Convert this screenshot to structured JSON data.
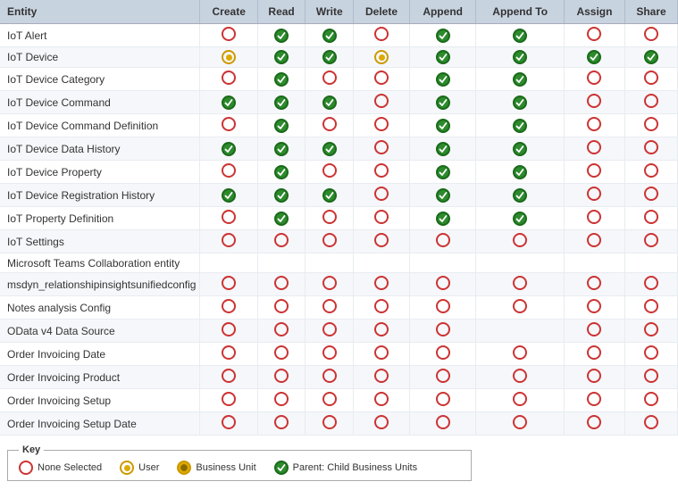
{
  "header": {
    "columns": [
      "Entity",
      "Create",
      "Read",
      "Write",
      "Delete",
      "Append",
      "Append To",
      "Assign",
      "Share"
    ]
  },
  "rows": [
    {
      "entity": "IoT Alert",
      "create": "none",
      "read": "parent",
      "write": "parent",
      "delete": "none",
      "append": "parent",
      "appendTo": "parent",
      "assign": "none",
      "share": "none"
    },
    {
      "entity": "IoT Device",
      "create": "user",
      "read": "parent",
      "write": "parent",
      "delete": "user",
      "append": "parent",
      "appendTo": "parent",
      "assign": "parent",
      "share": "parent"
    },
    {
      "entity": "IoT Device Category",
      "create": "none",
      "read": "parent",
      "write": "none",
      "delete": "none",
      "append": "parent",
      "appendTo": "parent",
      "assign": "none",
      "share": "none"
    },
    {
      "entity": "IoT Device Command",
      "create": "parent",
      "read": "parent",
      "write": "parent",
      "delete": "none",
      "append": "parent",
      "appendTo": "parent",
      "assign": "none",
      "share": "none"
    },
    {
      "entity": "IoT Device Command Definition",
      "create": "none",
      "read": "parent",
      "write": "none",
      "delete": "none",
      "append": "parent",
      "appendTo": "parent",
      "assign": "none",
      "share": "none"
    },
    {
      "entity": "IoT Device Data History",
      "create": "parent",
      "read": "parent",
      "write": "parent",
      "delete": "none",
      "append": "parent",
      "appendTo": "parent",
      "assign": "none",
      "share": "none"
    },
    {
      "entity": "IoT Device Property",
      "create": "none",
      "read": "parent",
      "write": "none",
      "delete": "none",
      "append": "parent",
      "appendTo": "parent",
      "assign": "none",
      "share": "none"
    },
    {
      "entity": "IoT Device Registration History",
      "create": "parent",
      "read": "parent",
      "write": "parent",
      "delete": "none",
      "append": "parent",
      "appendTo": "parent",
      "assign": "none",
      "share": "none"
    },
    {
      "entity": "IoT Property Definition",
      "create": "none",
      "read": "parent",
      "write": "none",
      "delete": "none",
      "append": "parent",
      "appendTo": "parent",
      "assign": "none",
      "share": "none"
    },
    {
      "entity": "IoT Settings",
      "create": "none",
      "read": "none",
      "write": "none",
      "delete": "none",
      "append": "none",
      "appendTo": "none",
      "assign": "none",
      "share": "none"
    },
    {
      "entity": "Microsoft Teams Collaboration entity",
      "create": "",
      "read": "",
      "write": "",
      "delete": "",
      "append": "",
      "appendTo": "",
      "assign": "",
      "share": ""
    },
    {
      "entity": "msdyn_relationshipinsightsunifiedconfig",
      "create": "none",
      "read": "none",
      "write": "none",
      "delete": "none",
      "append": "none",
      "appendTo": "none",
      "assign": "none",
      "share": "none"
    },
    {
      "entity": "Notes analysis Config",
      "create": "none",
      "read": "none",
      "write": "none",
      "delete": "none",
      "append": "none",
      "appendTo": "none",
      "assign": "none",
      "share": "none"
    },
    {
      "entity": "OData v4 Data Source",
      "create": "none",
      "read": "none",
      "write": "none",
      "delete": "none",
      "append": "none",
      "appendTo": "",
      "assign": "none",
      "share": "none"
    },
    {
      "entity": "Order Invoicing Date",
      "create": "none",
      "read": "none",
      "write": "none",
      "delete": "none",
      "append": "none",
      "appendTo": "none",
      "assign": "none",
      "share": "none"
    },
    {
      "entity": "Order Invoicing Product",
      "create": "none",
      "read": "none",
      "write": "none",
      "delete": "none",
      "append": "none",
      "appendTo": "none",
      "assign": "none",
      "share": "none"
    },
    {
      "entity": "Order Invoicing Setup",
      "create": "none",
      "read": "none",
      "write": "none",
      "delete": "none",
      "append": "none",
      "appendTo": "none",
      "assign": "none",
      "share": "none"
    },
    {
      "entity": "Order Invoicing Setup Date",
      "create": "none",
      "read": "none",
      "write": "none",
      "delete": "none",
      "append": "none",
      "appendTo": "none",
      "assign": "none",
      "share": "none"
    }
  ],
  "key": {
    "title": "Key",
    "items": [
      {
        "label": "None Selected",
        "type": "none"
      },
      {
        "label": "User",
        "type": "user"
      },
      {
        "label": "Business Unit",
        "type": "bu"
      },
      {
        "label": "Parent: Child Business Units",
        "type": "parent"
      }
    ]
  }
}
